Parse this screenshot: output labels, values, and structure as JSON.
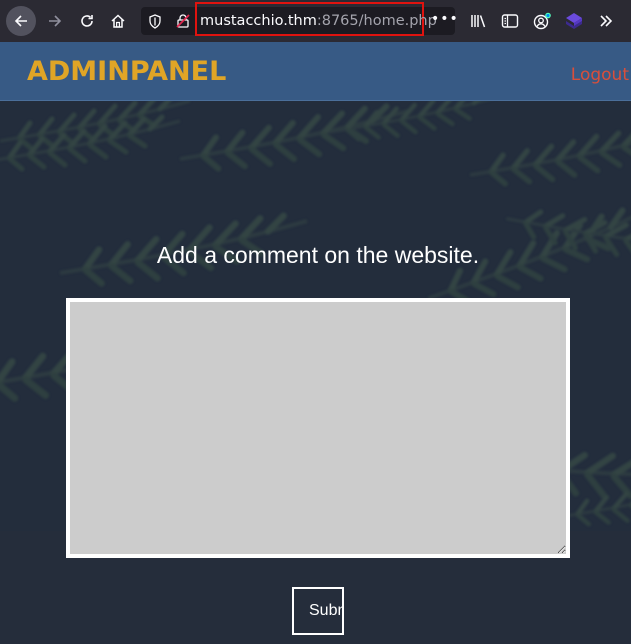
{
  "browser": {
    "url_host": "mustacchio.thm",
    "url_rest": ":8765/home.php",
    "more_label": "•••",
    "icons": {
      "back": "back-arrow-icon",
      "forward": "forward-arrow-icon",
      "reload": "reload-icon",
      "home": "home-icon",
      "tracking": "shield-icon",
      "insecure": "insecure-lock-icon",
      "library": "library-icon",
      "reader": "reader-view-icon",
      "account": "account-icon",
      "extension": "extension-icon",
      "overflow": "chevron-double-right-icon"
    },
    "colors": {
      "toolbar": "#2b2a33",
      "urlbar": "#1c1b22",
      "highlight": "#e0130f"
    }
  },
  "site": {
    "brand": "ADMINPANEL",
    "logout_label": "Logout",
    "heading": "Add a comment on the website.",
    "comment_value": "",
    "submit_label": "Submit",
    "colors": {
      "header": "#375a85",
      "brand": "#e0a526",
      "logout": "#d94f3b",
      "textarea": "#cccccc"
    }
  }
}
